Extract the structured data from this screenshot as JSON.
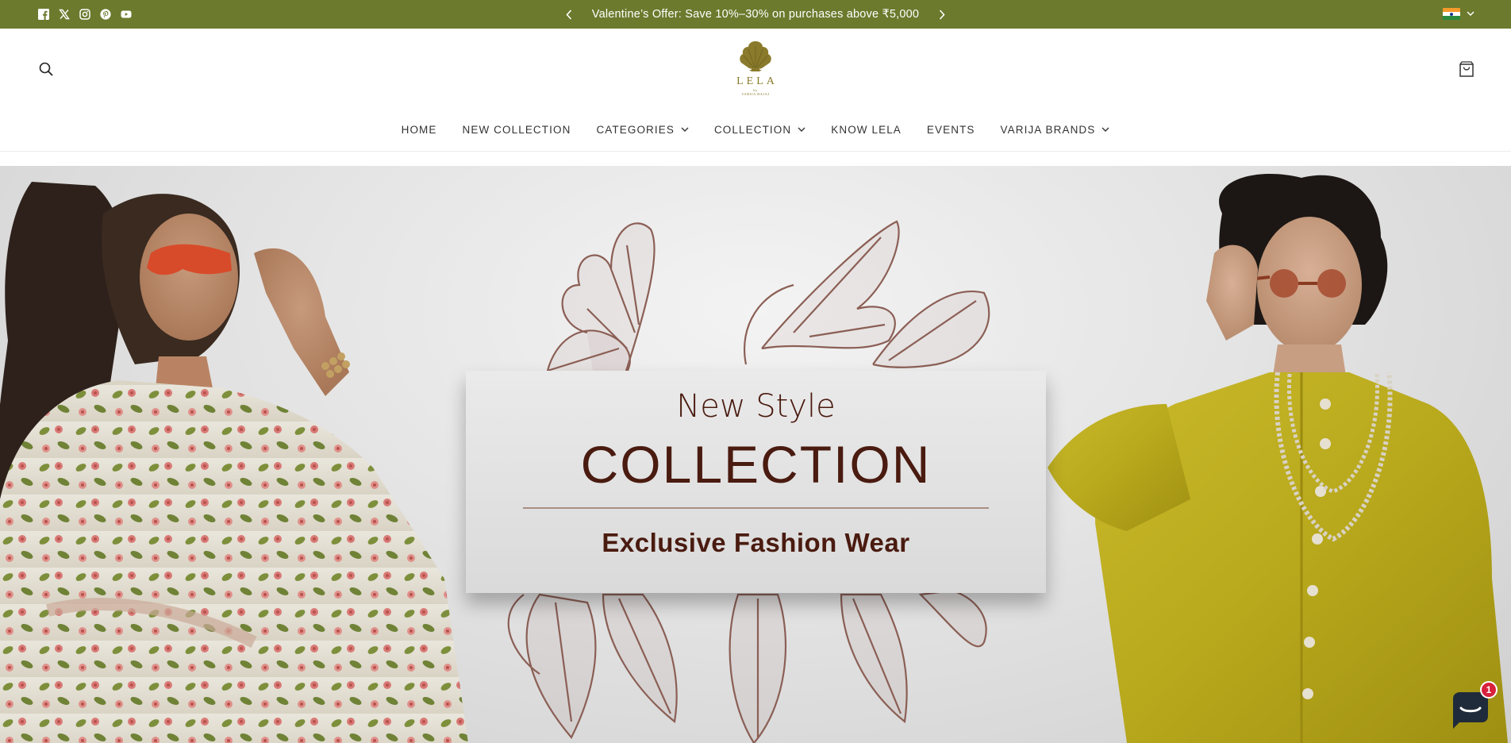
{
  "topbar": {
    "background": "#6b7a2d",
    "social_icons": [
      "facebook-icon",
      "x-icon",
      "instagram-icon",
      "pinterest-icon",
      "youtube-icon"
    ],
    "announcement": "Valentine’s Offer: Save 10%–30% on purchases above ₹5,000",
    "country_flag": "india-flag-icon"
  },
  "header": {
    "logo": {
      "wordmark": "LELA",
      "byline": "by",
      "brand": "VARIJA BAJAJ"
    },
    "nav": [
      {
        "label": "HOME",
        "dropdown": false
      },
      {
        "label": "NEW COLLECTION",
        "dropdown": false
      },
      {
        "label": "CATEGORIES",
        "dropdown": true
      },
      {
        "label": "COLLECTION",
        "dropdown": true
      },
      {
        "label": "KNOW LELA",
        "dropdown": false
      },
      {
        "label": "EVENTS",
        "dropdown": false
      },
      {
        "label": "VARIJA BRANDS",
        "dropdown": true
      }
    ]
  },
  "hero": {
    "kicker": "New Style",
    "title": "COLLECTION",
    "subtitle": "Exclusive Fashion Wear",
    "text_color": "#4a1b10",
    "leaf_color": "#8b5f55"
  },
  "chat": {
    "badge_count": "1",
    "color": "#1f2b3a"
  }
}
